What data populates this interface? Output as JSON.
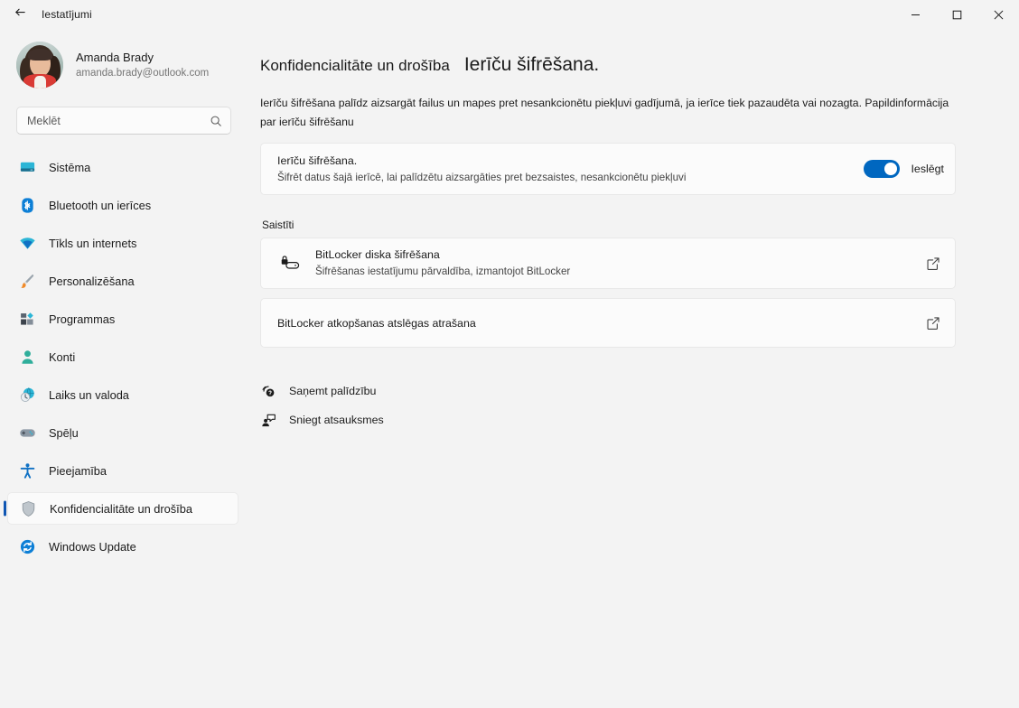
{
  "window": {
    "title": "Iestatījumi",
    "back_icon": "back-arrow-icon",
    "minimize_label": "–",
    "maximize_label": "□",
    "close_label": "✕"
  },
  "account": {
    "name": "Amanda Brady",
    "email": "amanda.brady@outlook.com",
    "avatar_icon": "user-avatar"
  },
  "search": {
    "placeholder": "Meklēt",
    "value": "",
    "icon": "search-icon"
  },
  "sidebar": {
    "items": [
      {
        "label": "Sistēma",
        "icon": "monitor-icon",
        "selected": false
      },
      {
        "label": "Bluetooth un ierīces",
        "icon": "bluetooth-icon",
        "selected": false
      },
      {
        "label": "Tīkls un internets",
        "icon": "wifi-icon",
        "selected": false
      },
      {
        "label": "Personalizēšana",
        "icon": "paintbrush-icon",
        "selected": false
      },
      {
        "label": "Programmas",
        "icon": "apps-icon",
        "selected": false
      },
      {
        "label": "Konti",
        "icon": "person-icon",
        "selected": false
      },
      {
        "label": "Laiks un valoda",
        "icon": "clock-globe-icon",
        "selected": false
      },
      {
        "label": "Spēļu",
        "icon": "gamepad-icon",
        "selected": false
      },
      {
        "label": "Pieejamība",
        "icon": "accessibility-icon",
        "selected": false
      },
      {
        "label": "Konfidencialitāte un drošība",
        "icon": "shield-icon",
        "selected": true
      },
      {
        "label": "Windows Update",
        "icon": "update-icon",
        "selected": false
      }
    ]
  },
  "main": {
    "breadcrumb": "Konfidencialitāte un drošība",
    "title": "Ierīču šifrēšana.",
    "description": "Ierīču šifrēšana palīdz aizsargāt failus un mapes pret nesankcionētu piekļuvi gadījumā, ja ierīce tiek pazaudēta vai nozagta. Papildinformācija par ierīču šifrēšanu",
    "encryption_card": {
      "title": "Ierīču šifrēšana.",
      "subtitle": "Šifrēt datus šajā ierīcē, lai palīdzētu aizsargāties pret bezsaistes, nesankcionētu piekļuvi",
      "toggle_state": "Ieslēgt",
      "toggle_on": true,
      "toggle_color": "#0067C0"
    },
    "related_label": "Saistīti",
    "related_cards": [
      {
        "title": "BitLocker diska šifrēšana",
        "subtitle": "Šifrēšanas iestatījumu pārvaldība, izmantojot BitLocker",
        "icon": "drive-lock-icon",
        "action_icon": "external-link-icon"
      },
      {
        "title": "BitLocker atkopšanas atslēgas atrašana",
        "subtitle": "",
        "icon": "",
        "action_icon": "external-link-icon"
      }
    ],
    "help_links": [
      {
        "label": "Saņemt palīdzību",
        "icon": "help-question-icon"
      },
      {
        "label": "Sniegt atsauksmes",
        "icon": "feedback-icon"
      }
    ]
  },
  "colors": {
    "page_background": "#F3F3F3",
    "card_background": "#FBFBFB",
    "accent": "#0067C0",
    "selection_bar": "#0F56B3"
  }
}
